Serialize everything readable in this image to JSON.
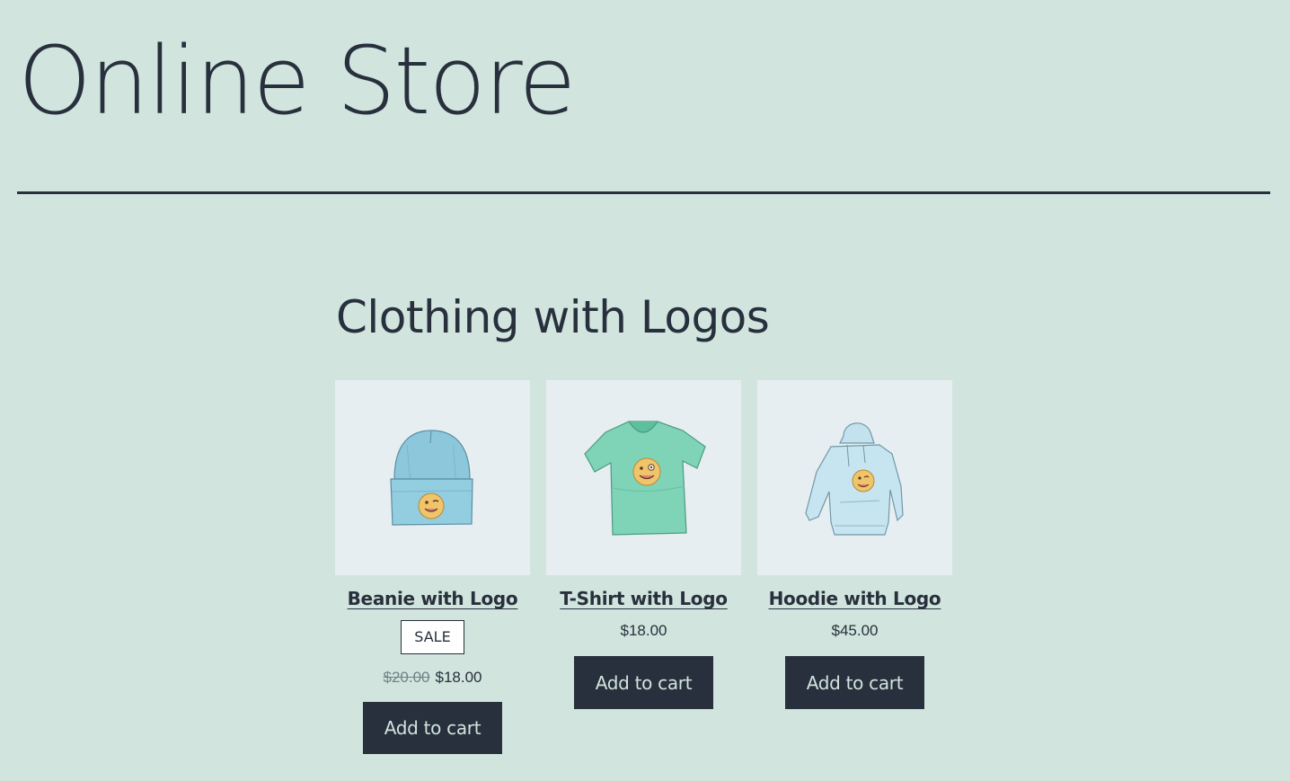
{
  "site": {
    "title": "Online Store"
  },
  "section": {
    "title": "Clothing with Logos"
  },
  "products": [
    {
      "name": "Beanie with Logo",
      "badge": "SALE",
      "old_price": "$20.00",
      "price": "$18.00",
      "button": "Add to cart",
      "icon": "beanie-image"
    },
    {
      "name": "T-Shirt with Logo",
      "price": "$18.00",
      "button": "Add to cart",
      "icon": "tshirt-image"
    },
    {
      "name": "Hoodie with Logo",
      "price": "$45.00",
      "button": "Add to cart",
      "icon": "hoodie-image"
    }
  ],
  "colors": {
    "background": "#d1e4dd",
    "text": "#28303d",
    "thumb_bg": "#e7eef1",
    "button_bg": "#28303d",
    "button_text": "#d1e4dd"
  }
}
